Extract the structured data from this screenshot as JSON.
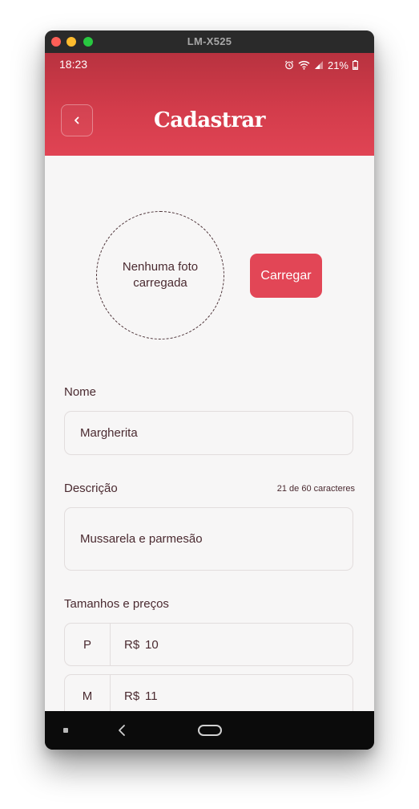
{
  "window": {
    "title": "LM-X525"
  },
  "status_bar": {
    "time": "18:23",
    "battery": "21%"
  },
  "header": {
    "title": "Cadastrar",
    "back_icon": "chevron-left-icon"
  },
  "photo": {
    "placeholder": "Nenhuma foto carregada",
    "upload_label": "Carregar"
  },
  "form": {
    "name_label": "Nome",
    "name_value": "Margherita",
    "description_label": "Descrição",
    "description_counter": "21 de 60 caracteres",
    "description_value": "Mussarela e parmesão",
    "sizes_label": "Tamanhos e preços",
    "sizes": [
      {
        "size": "P",
        "currency": "R$",
        "price": "10"
      },
      {
        "size": "M",
        "currency": "R$",
        "price": "11"
      },
      {
        "size": "",
        "currency": "",
        "price": ""
      }
    ]
  },
  "colors": {
    "brand": "#e24656",
    "header_top": "#b8323f",
    "text": "#4a2a30"
  }
}
